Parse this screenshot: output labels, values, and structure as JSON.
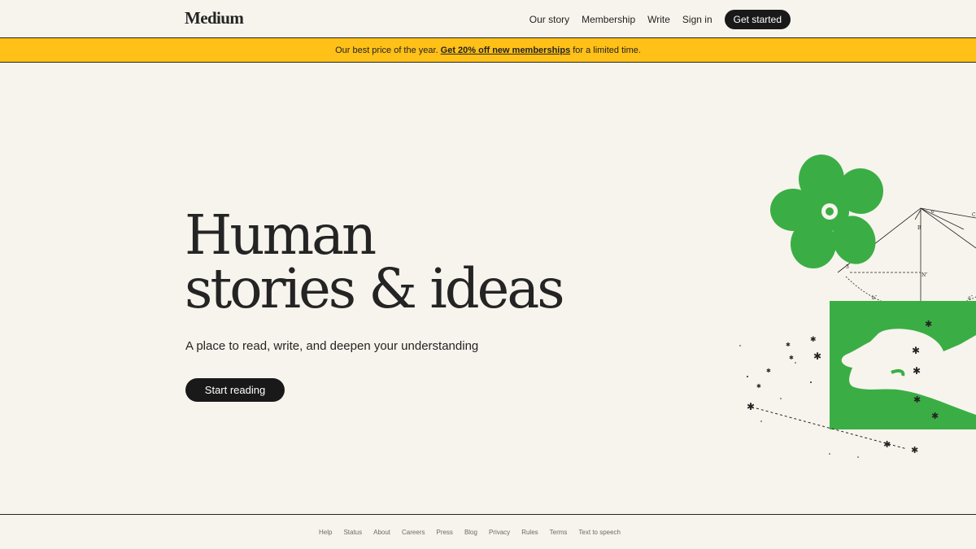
{
  "header": {
    "logo": "Medium",
    "nav": {
      "our_story": "Our story",
      "membership": "Membership",
      "write": "Write",
      "sign_in": "Sign in",
      "get_started": "Get started"
    }
  },
  "banner": {
    "prefix": "Our best price of the year.",
    "link": "Get 20% off new memberships",
    "suffix": "for a limited time."
  },
  "hero": {
    "title_line1": "Human",
    "title_line2": "stories & ideas",
    "subtitle": "A place to read, write, and deepen your understanding",
    "cta": "Start reading"
  },
  "footer": {
    "links": [
      "Help",
      "Status",
      "About",
      "Careers",
      "Press",
      "Blog",
      "Privacy",
      "Rules",
      "Terms",
      "Text to speech"
    ]
  },
  "colors": {
    "background": "#f7f4ed",
    "banner": "#ffc017",
    "illustration_green": "#3aae45",
    "text": "#242424"
  }
}
